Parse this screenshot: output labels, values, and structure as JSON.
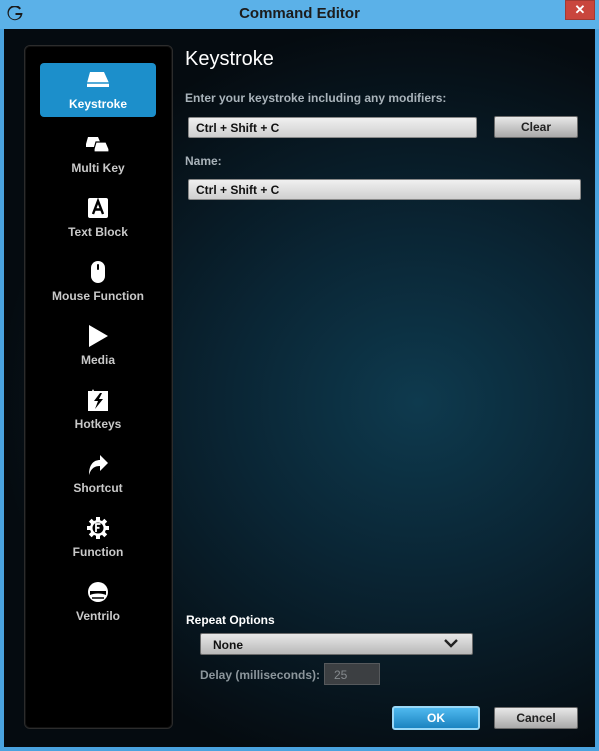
{
  "window": {
    "title": "Command Editor",
    "close_label": "✕"
  },
  "sidebar": {
    "items": [
      {
        "label": "Keystroke",
        "icon": "keystroke-icon",
        "active": true
      },
      {
        "label": "Multi Key",
        "icon": "multi-key-icon",
        "active": false
      },
      {
        "label": "Text Block",
        "icon": "text-block-icon",
        "active": false
      },
      {
        "label": "Mouse Function",
        "icon": "mouse-icon",
        "active": false
      },
      {
        "label": "Media",
        "icon": "play-icon",
        "active": false
      },
      {
        "label": "Hotkeys",
        "icon": "hotkeys-icon",
        "active": false
      },
      {
        "label": "Shortcut",
        "icon": "shortcut-arrow-icon",
        "active": false
      },
      {
        "label": "Function",
        "icon": "function-gear-icon",
        "active": false
      },
      {
        "label": "Ventrilo",
        "icon": "headset-icon",
        "active": false
      }
    ]
  },
  "main": {
    "heading": "Keystroke",
    "keystroke_prompt": "Enter your keystroke including any modifiers:",
    "keystroke_value": "Ctrl + Shift + C",
    "clear_label": "Clear",
    "name_label": "Name:",
    "name_value": "Ctrl + Shift + C"
  },
  "repeat": {
    "label": "Repeat Options",
    "selected": "None",
    "delay_label": "Delay (milliseconds):",
    "delay_value": "25"
  },
  "footer": {
    "ok_label": "OK",
    "cancel_label": "Cancel"
  },
  "colors": {
    "accent": "#1c8fcb",
    "titlebar": "#5bb1e8",
    "close": "#c9463d"
  }
}
